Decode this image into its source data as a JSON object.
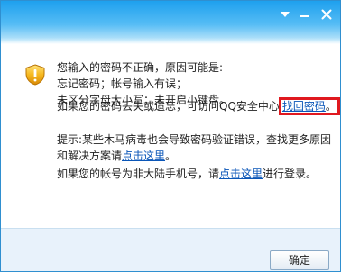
{
  "window": {
    "controls": {
      "menu_icon": "chevron-down-icon",
      "minimize_icon": "minimize-icon",
      "close_icon": "close-icon"
    },
    "warning_icon": "warning-shield-icon"
  },
  "message": {
    "line1": "您输入的密码不正确，原因可能是:",
    "line2": "忘记密码；帐号输入有误；",
    "line3": "未区分字母大小写；未开启小键盘。",
    "lost_prefix": "如果您的密码丢失或遗忘，可访问QQ安全中心",
    "lost_link": "找回密码",
    "lost_suffix": "。",
    "tip_prefix": "提示:某些木马病毒也会导致密码验证错误，查找更多原因",
    "tip_line2_prefix": "和解决方案请",
    "tip_link": "点击这里",
    "tip_suffix": "。",
    "phone_prefix": "如果您的帐号为非大陆手机号，请",
    "phone_link": "点击这里",
    "phone_suffix": "进行登录。"
  },
  "footer": {
    "ok_label": "确定"
  },
  "colors": {
    "titlebar": "#1ea0ee",
    "link": "#0a56b8",
    "highlight_border": "#e0181f",
    "footer": "#e8f2fb"
  }
}
